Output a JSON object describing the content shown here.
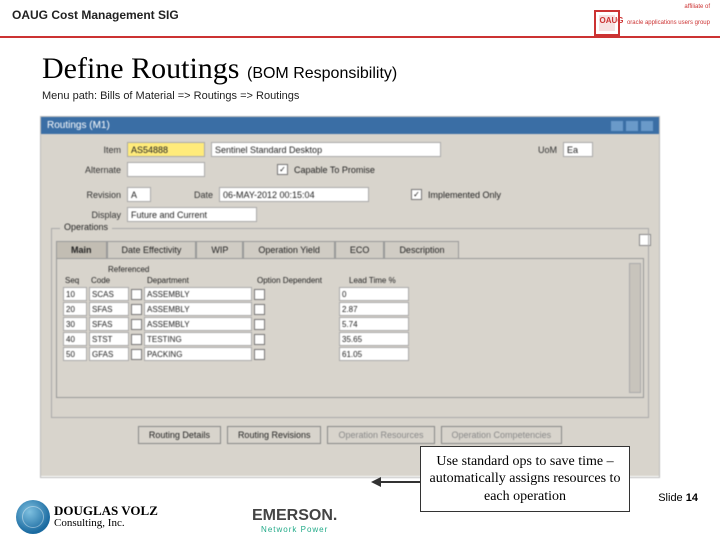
{
  "header": {
    "sig": "OAUG Cost Management SIG",
    "oaug_brand": "OAUG",
    "oaug_sub": "oracle applications users group",
    "affiliate": "affiliate of"
  },
  "title": {
    "main": "Define Routings",
    "sub": "(BOM Responsibility)"
  },
  "menu_path": "Menu path:  Bills of Material => Routings => Routings",
  "win": {
    "title": "Routings (M1)",
    "item_lbl": "Item",
    "item_val": "AS54888",
    "item_desc": "Sentinel Standard Desktop",
    "uom_lbl": "UoM",
    "uom_val": "Ea",
    "alt_lbl": "Alternate",
    "ctp_lbl": "Capable To Promise",
    "ctp_chk": "✓",
    "rev_lbl": "Revision",
    "rev_val": "A",
    "date_lbl": "Date",
    "date_val": "06-MAY-2012 00:15:04",
    "impl_lbl": "Implemented Only",
    "impl_chk": "✓",
    "disp_lbl": "Display",
    "disp_val": "Future and Current",
    "ops_leg": "Operations",
    "tabs": [
      "Main",
      "Date Effectivity",
      "WIP",
      "Operation Yield",
      "ECO",
      "Description"
    ],
    "ref_lbl": "Referenced",
    "cols": {
      "seq": "Seq",
      "code": "Code",
      "dept": "Department",
      "optdept": "Option Dependent",
      "lead": "Lead Time %"
    },
    "rows": [
      {
        "seq": "10",
        "code": "SCAS",
        "dept": "ASSEMBLY",
        "opt": "",
        "lead": "0"
      },
      {
        "seq": "20",
        "code": "SFAS",
        "dept": "ASSEMBLY",
        "opt": "",
        "lead": "2.87"
      },
      {
        "seq": "30",
        "code": "SFAS",
        "dept": "ASSEMBLY",
        "opt": "",
        "lead": "5.74"
      },
      {
        "seq": "40",
        "code": "STST",
        "dept": "TESTING",
        "opt": "",
        "lead": "35.65"
      },
      {
        "seq": "50",
        "code": "GFAS",
        "dept": "PACKING",
        "opt": "",
        "lead": "61.05"
      }
    ],
    "btns": {
      "rd": "Routing Details",
      "rr": "Routing Revisions",
      "or": "Operation Resources",
      "oc": "Operation Competencies"
    }
  },
  "callout": "Use standard ops to save time – automatically assigns resources to each operation",
  "slide": {
    "lbl": "Slide ",
    "num": "14"
  },
  "logos": {
    "dvc_l1": "DOUGLAS VOLZ",
    "dvc_l2": "Consulting, Inc.",
    "em": "EMERSON.",
    "em_sub": "Network Power"
  }
}
